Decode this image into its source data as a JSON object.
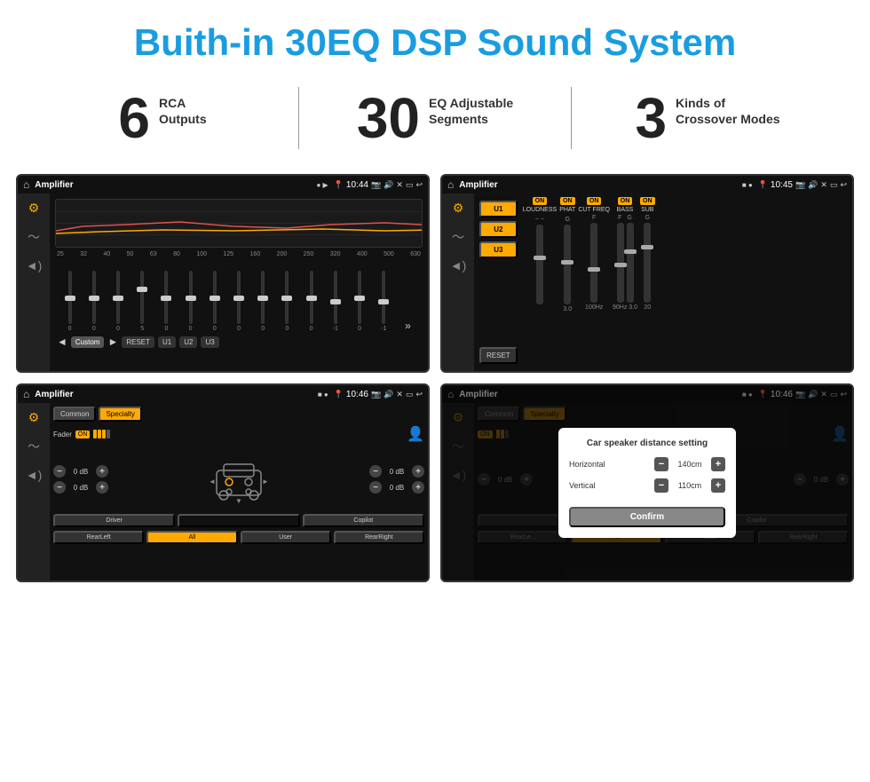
{
  "page": {
    "title": "Buith-in 30EQ DSP Sound System"
  },
  "stats": [
    {
      "number": "6",
      "label": "RCA\nOutputs"
    },
    {
      "number": "30",
      "label": "EQ Adjustable\nSegments"
    },
    {
      "number": "3",
      "label": "Kinds of\nCrossover Modes"
    }
  ],
  "screens": [
    {
      "id": "screen-1",
      "statusBar": {
        "appName": "Amplifier",
        "time": "10:44"
      },
      "type": "eq"
    },
    {
      "id": "screen-2",
      "statusBar": {
        "appName": "Amplifier",
        "time": "10:45"
      },
      "type": "dsp"
    },
    {
      "id": "screen-3",
      "statusBar": {
        "appName": "Amplifier",
        "time": "10:46"
      },
      "type": "crossover"
    },
    {
      "id": "screen-4",
      "statusBar": {
        "appName": "Amplifier",
        "time": "10:46"
      },
      "type": "crossover-dialog"
    }
  ],
  "eq": {
    "freqLabels": [
      "25",
      "32",
      "40",
      "50",
      "63",
      "80",
      "100",
      "125",
      "160",
      "200",
      "250",
      "320",
      "400",
      "500",
      "630"
    ],
    "values": [
      "0",
      "0",
      "0",
      "5",
      "0",
      "0",
      "0",
      "0",
      "0",
      "0",
      "0",
      "-1",
      "0",
      "-1"
    ],
    "preset": "Custom",
    "buttons": [
      "RESET",
      "U1",
      "U2",
      "U3"
    ]
  },
  "dsp": {
    "presets": [
      "U1",
      "U2",
      "U3"
    ],
    "channels": [
      {
        "label": "LOUDNESS",
        "on": true
      },
      {
        "label": "PHAT",
        "on": true
      },
      {
        "label": "CUT FREQ",
        "on": true
      },
      {
        "label": "BASS",
        "on": true
      },
      {
        "label": "SUB",
        "on": true
      }
    ],
    "resetLabel": "RESET"
  },
  "crossover": {
    "tabs": [
      "Common",
      "Specialty"
    ],
    "faderLabel": "Fader",
    "faderOn": "ON",
    "dbValues": [
      "0 dB",
      "0 dB",
      "0 dB",
      "0 dB"
    ],
    "bottomButtons": [
      "Driver",
      "",
      "Copilot",
      "RearLeft",
      "All",
      "User",
      "RearRight"
    ]
  },
  "dialog": {
    "title": "Car speaker distance setting",
    "fields": [
      {
        "label": "Horizontal",
        "value": "140cm"
      },
      {
        "label": "Vertical",
        "value": "110cm"
      }
    ],
    "confirmLabel": "Confirm",
    "dbValues": [
      "0 dB",
      "0 dB"
    ]
  }
}
